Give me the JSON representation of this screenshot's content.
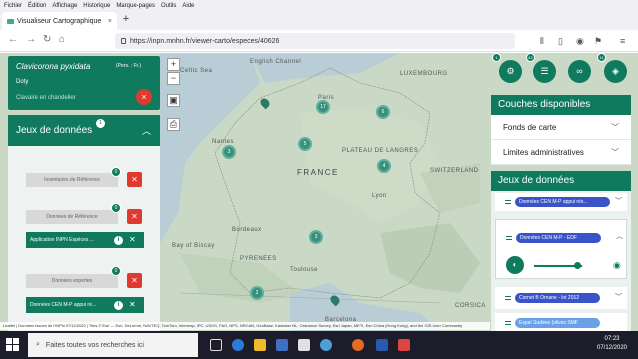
{
  "browser": {
    "menu": [
      "Fichier",
      "Édition",
      "Affichage",
      "Historique",
      "Marque-pages",
      "Outils",
      "Aide"
    ],
    "tab_title": "Visualiseur Cartographique",
    "tab_close": "×",
    "new_tab": "+",
    "url": "https://inpn.mnhn.fr/viewer-carto/especes/40626"
  },
  "species": {
    "name": "Clavicorona pyxidata",
    "author": "(Pers. : Fr.)",
    "author_suffix": "Doty",
    "status": "Clavaire en chandelier",
    "close": "×"
  },
  "left_panel": {
    "title": "Jeux de données",
    "badge": "1",
    "groups": [
      {
        "label": "Inventaires de Référence",
        "badge": "0",
        "pill": null
      },
      {
        "label": "Données de Référence",
        "badge": "0",
        "pill": "Application INPN Espèces ..."
      },
      {
        "label": "Données expertes",
        "badge": "0",
        "pill": "Données CEN M-P appui ré..."
      }
    ]
  },
  "map": {
    "country_label": "FRANCE",
    "labels": [
      {
        "text": "Celtic Sea"
      },
      {
        "text": "English Channel"
      },
      {
        "text": "LUXEMBOURG"
      },
      {
        "text": "PLATEAU DE LANGRES"
      },
      {
        "text": "SWITZERLAND"
      },
      {
        "text": "Bordeaux"
      },
      {
        "text": "Toulouse"
      },
      {
        "text": "PYRENEES"
      },
      {
        "text": "CORSICA"
      },
      {
        "text": "Barcelona"
      },
      {
        "text": "Bay of Biscay"
      },
      {
        "text": "Paris"
      },
      {
        "text": "Lyon"
      },
      {
        "text": "Nantes"
      }
    ],
    "clusters": [
      {
        "count": "17"
      },
      {
        "count": "6"
      },
      {
        "count": "3"
      },
      {
        "count": "5"
      },
      {
        "count": "4"
      },
      {
        "count": "3"
      },
      {
        "count": "2"
      }
    ],
    "attribution": "Leaflet | Données issues de l'INPN 07/12/2020 | Tiles © Esri — Esri, DeLorme, NAVTEQ, TomTom, Intermap, iPC, USGS, FAO, NPS, NRCAN, GeoBase, Kadaster NL, Ordnance Survey, Esri Japan, METI, Esri China (Hong Kong), and the GIS User Community"
  },
  "fabs": [
    {
      "icon": "gear-icon",
      "badge": "1"
    },
    {
      "icon": "list-icon",
      "badge": "42"
    },
    {
      "icon": "link-icon",
      "badge": ""
    },
    {
      "icon": "layers-icon",
      "badge": "11"
    }
  ],
  "right_panel": {
    "couches_title": "Couches disponibles",
    "couches": [
      {
        "label": "Fonds de carte"
      },
      {
        "label": "Limites administratives"
      }
    ],
    "jeux_title": "Jeux de données",
    "items": [
      {
        "label": "Données CEN M-P appui rés...",
        "color": "#3a53c9"
      },
      {
        "label": "Données CEN M-P - EDF",
        "color": "#3a53c9"
      },
      {
        "label": "Cornet B Ornane - lot 2012",
        "color": "#3a53c9"
      },
      {
        "label": "Espaï Sudées (olives SMF",
        "color": "#6aa0e8"
      }
    ]
  },
  "taskbar": {
    "search_placeholder": "Faites toutes vos recherches ici",
    "time": "07:23",
    "date": "07/12/2020"
  },
  "colors": {
    "primary": "#0f7a5e",
    "danger": "#e03a2f"
  }
}
